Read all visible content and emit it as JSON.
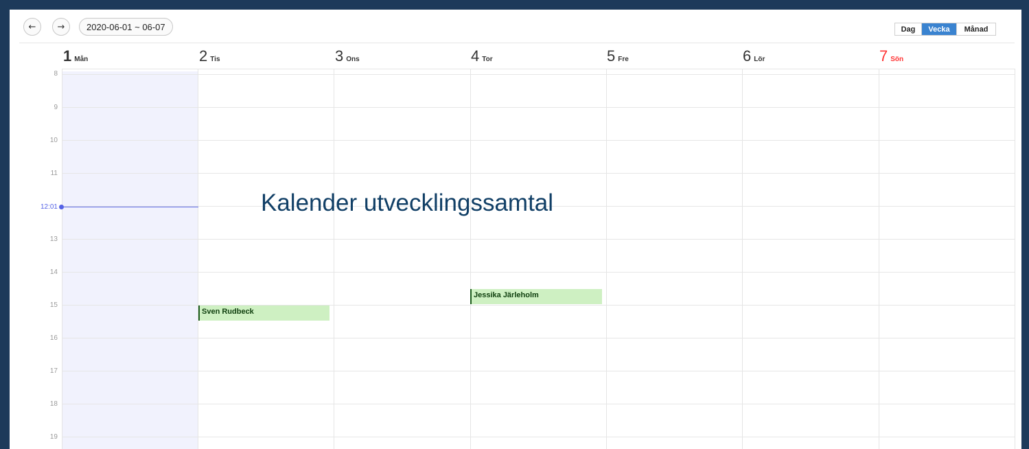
{
  "toolbar": {
    "prev_icon": "←",
    "next_icon": "→",
    "date_range": "2020-06-01 ~ 06-07",
    "views": {
      "day": "Dag",
      "week": "Vecka",
      "month": "Månad"
    },
    "active_view": "Vecka",
    "accent_color": "#3a83d0"
  },
  "days": [
    {
      "num": "1",
      "name": "Mån",
      "today": true
    },
    {
      "num": "2",
      "name": "Tis"
    },
    {
      "num": "3",
      "name": "Ons"
    },
    {
      "num": "4",
      "name": "Tor"
    },
    {
      "num": "5",
      "name": "Fre"
    },
    {
      "num": "6",
      "name": "Lör"
    },
    {
      "num": "7",
      "name": "Sön",
      "holiday": true
    }
  ],
  "hours": [
    "8",
    "9",
    "10",
    "11",
    "13",
    "14",
    "15",
    "16",
    "17",
    "18",
    "19"
  ],
  "now_label": "12:01",
  "events": [
    {
      "title": "Sven Rudbeck",
      "day": "Tis"
    },
    {
      "title": "Jessika Järleholm",
      "day": "Tor"
    }
  ],
  "overlay_title": "Kalender utvecklingssamtal",
  "colors": {
    "sunday": "#ff3333",
    "now": "#5563e6",
    "event_bg": "#cef0c2",
    "event_border": "#1d5c1d"
  }
}
